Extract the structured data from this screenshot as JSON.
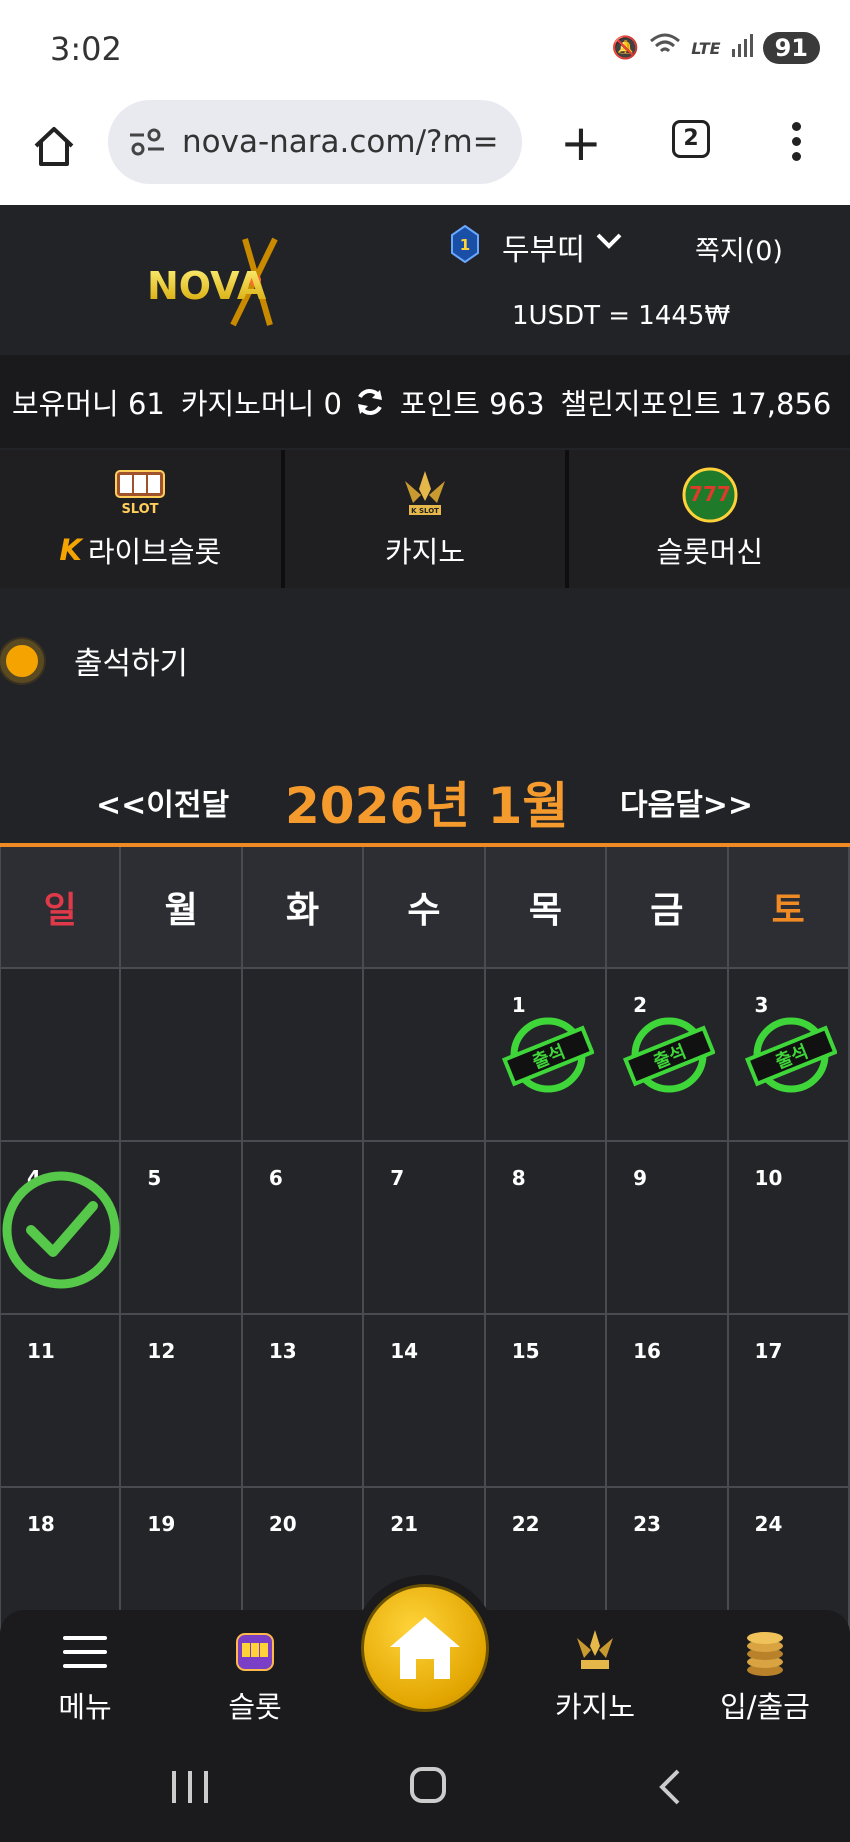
{
  "status": {
    "time": "3:02",
    "battery": "91"
  },
  "browser": {
    "url": "nova-nara.com/?m=",
    "tab_count": "2"
  },
  "header": {
    "logo_text": "NOVA",
    "level": "1",
    "username": "두부띠",
    "messages_label": "쪽지(0)",
    "exchange_rate": "1USDT = 1445₩"
  },
  "balances": {
    "money": "보유머니 61",
    "casino_money": "카지노머니 0",
    "points": "포인트 963",
    "challenge_points": "챌린지포인트 17,856"
  },
  "categories": [
    {
      "label": "라이브슬롯",
      "icon": "live-slot-icon"
    },
    {
      "label": "카지노",
      "icon": "k-slot-icon"
    },
    {
      "label": "슬롯머신",
      "icon": "777-slots-icon"
    }
  ],
  "attendance": {
    "title": "출석하기",
    "prev_month": "<<이전달",
    "current_month": "2026년 1월",
    "next_month": "다음달>>",
    "weekdays": [
      "일",
      "월",
      "화",
      "수",
      "목",
      "금",
      "토"
    ],
    "stamp_text": "출석",
    "weeks": [
      [
        "",
        "",
        "",
        "",
        "1",
        "2",
        "3"
      ],
      [
        "4",
        "5",
        "6",
        "7",
        "8",
        "9",
        "10"
      ],
      [
        "11",
        "12",
        "13",
        "14",
        "15",
        "16",
        "17"
      ],
      [
        "18",
        "19",
        "20",
        "21",
        "22",
        "23",
        "24"
      ]
    ],
    "attended_days": [
      "1",
      "2",
      "3"
    ],
    "checked_today": "4"
  },
  "bottom_nav": {
    "menu": "메뉴",
    "slot": "슬롯",
    "casino": "카지노",
    "deposit": "입/출금"
  },
  "colors": {
    "accent_orange": "#f08a24",
    "stamp_green": "#3fd63a",
    "sunday_red": "#e03a4a",
    "background": "#222327"
  }
}
